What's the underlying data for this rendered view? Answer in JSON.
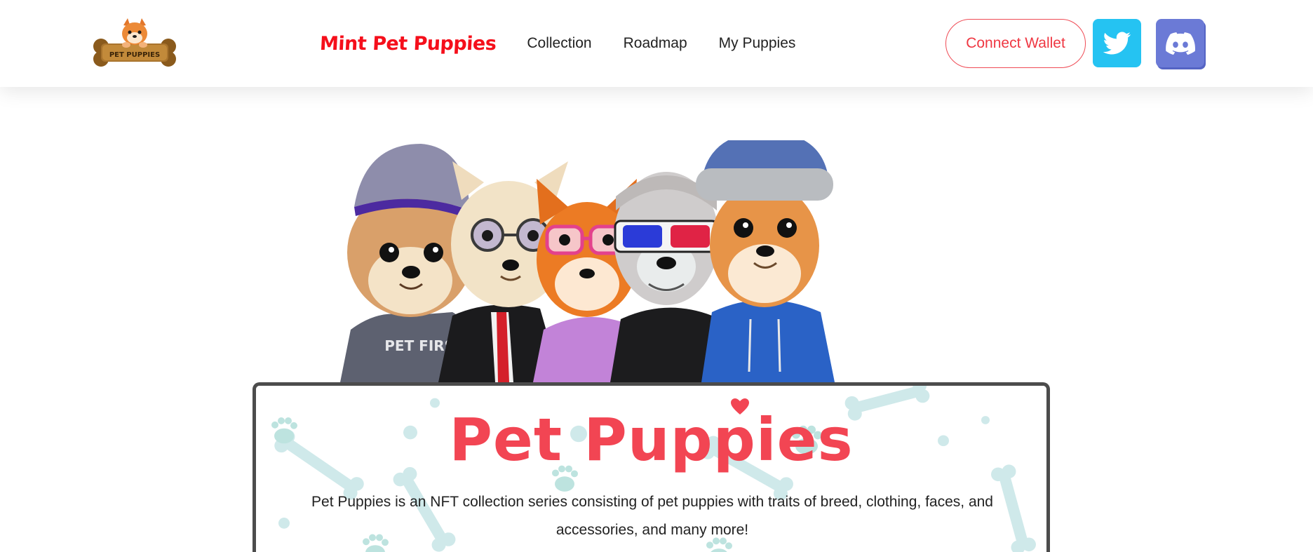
{
  "header": {
    "logo_text": "PET PUPPIES",
    "nav": {
      "mint": "Mint Pet Puppies",
      "collection": "Collection",
      "roadmap": "Roadmap",
      "my_puppies": "My Puppies"
    },
    "connect_wallet": "Connect Wallet",
    "twitter_icon": "twitter-icon",
    "discord_icon": "discord-icon"
  },
  "hero": {
    "shirt_text": "PET FIRST",
    "title": "Pet Puppies",
    "description": "Pet Puppies is an NFT collection series consisting of pet puppies with traits of breed, clothing, faces, and accessories, and many more!"
  },
  "colors": {
    "accent_red": "#f24553",
    "twitter_blue": "#25c3f2",
    "discord_purple": "#6b7ad6",
    "card_border": "#4c4c4c"
  }
}
